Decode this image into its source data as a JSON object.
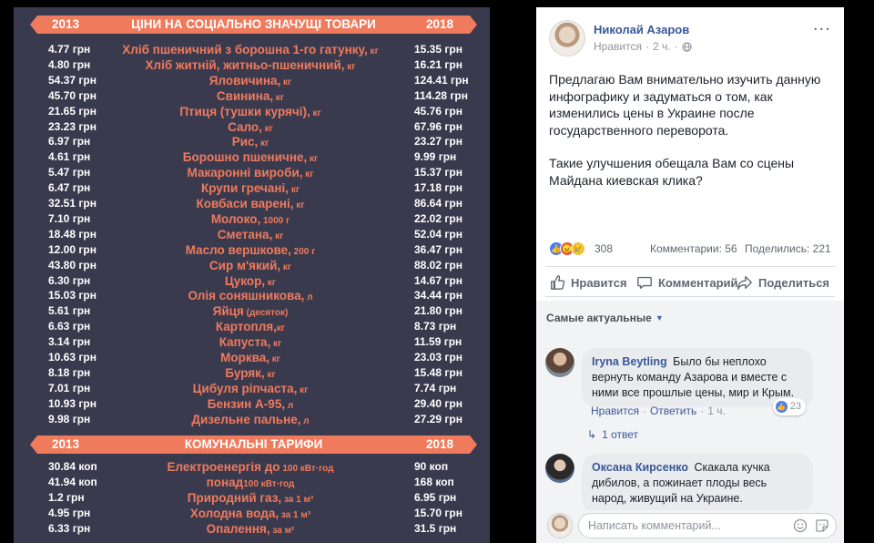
{
  "infographic": {
    "header_left_year": "2013",
    "header_right_year": "2018",
    "goods_title": "ЦІНИ НА СОЦІАЛЬНО ЗНАЧУЩІ ТОВАРИ",
    "tariffs_title": "КОМУНАЛЬНІ ТАРИФИ",
    "goods": [
      {
        "old": "4.77 грн",
        "name": "Хліб пшеничний з борошна 1-го гатунку,",
        "unit": " кг",
        "new": "15.35 грн"
      },
      {
        "old": "4.80 грн",
        "name": "Хліб житній, житньо-пшеничний,",
        "unit": " кг",
        "new": "16.21 грн"
      },
      {
        "old": "54.37 грн",
        "name": "Яловичина,",
        "unit": " кг",
        "new": "124.41 грн"
      },
      {
        "old": "45.70 грн",
        "name": "Свинина,",
        "unit": " кг",
        "new": "114.28 грн"
      },
      {
        "old": "21.65 грн",
        "name": "Птиця (тушки курячі),",
        "unit": " кг",
        "new": "45.76 грн"
      },
      {
        "old": "23.23 грн",
        "name": "Сало,",
        "unit": " кг",
        "new": "67.96 грн"
      },
      {
        "old": "6.97 грн",
        "name": "Рис,",
        "unit": " кг",
        "new": "23.27 грн"
      },
      {
        "old": "4.61 грн",
        "name": "Борошно пшеничне,",
        "unit": " кг",
        "new": "9.99 грн"
      },
      {
        "old": "5.47 грн",
        "name": "Макаронні вироби,",
        "unit": " кг",
        "new": "15.37 грн"
      },
      {
        "old": "6.47 грн",
        "name": "Крупи гречані,",
        "unit": " кг",
        "new": "17.18 грн"
      },
      {
        "old": "32.51 грн",
        "name": "Ковбаси варені,",
        "unit": " кг",
        "new": "86.64 грн"
      },
      {
        "old": "7.10 грн",
        "name": "Молоко,",
        "unit": " 1000 г",
        "new": "22.02 грн"
      },
      {
        "old": "18.48 грн",
        "name": "Сметана,",
        "unit": " кг",
        "new": "52.04 грн"
      },
      {
        "old": "12.00 грн",
        "name": "Масло вершкове,",
        "unit": " 200 г",
        "new": "36.47 грн"
      },
      {
        "old": "43.80 грн",
        "name": "Сир м'який,",
        "unit": " кг",
        "new": "88.02 грн"
      },
      {
        "old": "6.30 грн",
        "name": "Цукор,",
        "unit": " кг",
        "new": "14.67 грн"
      },
      {
        "old": "15.03 грн",
        "name": "Олія соняшникова,",
        "unit": " л",
        "new": "34.44 грн"
      },
      {
        "old": "5.61 грн",
        "name": "Яйця",
        "unit": " (десяток)",
        "new": "21.80 грн"
      },
      {
        "old": "6.63 грн",
        "name": "Картопля,",
        "unit": "кг",
        "new": "8.73 грн"
      },
      {
        "old": "3.14 грн",
        "name": "Капуста,",
        "unit": " кг",
        "new": "11.59 грн"
      },
      {
        "old": "10.63 грн",
        "name": "Морква,",
        "unit": " кг",
        "new": "23.03 грн"
      },
      {
        "old": "8.18 грн",
        "name": "Буряк,",
        "unit": " кг",
        "new": "15.48 грн"
      },
      {
        "old": "7.01 грн",
        "name": "Цибуля ріпчаста,",
        "unit": " кг",
        "new": "7.74 грн"
      },
      {
        "old": "10.93 грн",
        "name": "Бензин А-95,",
        "unit": " л",
        "new": "29.40 грн"
      },
      {
        "old": "9.98 грн",
        "name": "Дизельне пальне,",
        "unit": " л",
        "new": "27.29 грн"
      }
    ],
    "tariffs": [
      {
        "old": "30.84 коп",
        "name": "Електроенергія до",
        "unit": " 100 кВт·год",
        "new": "90 коп"
      },
      {
        "old": "41.94 коп",
        "name": "понад",
        "unit": "100 кВт·год",
        "new": "168 коп"
      },
      {
        "old": "1.2 грн",
        "name": "Природний газ,",
        "unit": " за 1 м³",
        "new": "6.95 грн"
      },
      {
        "old": "4.95 грн",
        "name": "Холодна вода,",
        "unit": " за 1 м³",
        "new": "15.70 грн"
      },
      {
        "old": "6.33 грн",
        "name": "Опалення,",
        "unit": " за м²",
        "new": "31.5 грн"
      }
    ]
  },
  "post": {
    "author": "Николай Азаров",
    "meta_like": "Нравится",
    "meta_dot": "·",
    "meta_time": "2 ч.",
    "meta_dot2": "·",
    "more": "···",
    "paragraphs": [
      "Предлагаю Вам внимательно изучить данную инфографику и задуматься о том, как изменились цены в Украине после государственного переворота.",
      "Такие улучшения обещала Вам со сцены Майдана киевская клика?"
    ],
    "reaction_count": "308",
    "comments_count": "Комментарии: 56",
    "shares_count": "Поделились: 221",
    "actions": {
      "like": "Нравится",
      "comment": "Комментарий",
      "share": "Поделиться"
    },
    "sort_label": "Самые актуальные",
    "comments": [
      {
        "author": "Iryna Beytling",
        "text": "Было бы неплохо вернуть команду Азарова и вместе с ними все прошлые цены, мир и Крым.",
        "likes": "23",
        "like_label": "Нравится",
        "reply_label": "Ответить",
        "time": "1 ч.",
        "dot": "·"
      },
      {
        "author": "Оксана Кирсенко",
        "text": "Скакала кучка дибилов, а пожинает плоды весь народ, живущий на Украине."
      }
    ],
    "replies_link": "1 ответ",
    "composer_placeholder": "Написать комментарий..."
  }
}
